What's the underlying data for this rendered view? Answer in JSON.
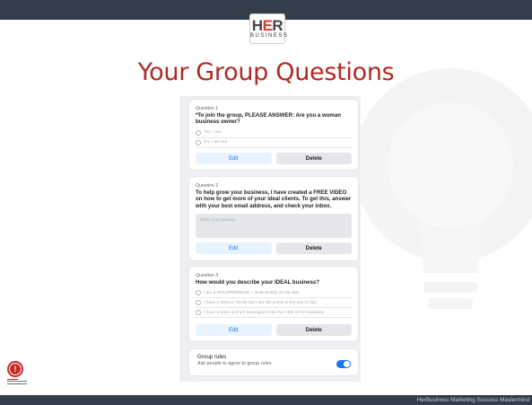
{
  "header": {
    "logo_top": "HER",
    "logo_sub": "BUSINESS"
  },
  "slide": {
    "title": "Your Group Questions"
  },
  "questions": [
    {
      "number": "Question 1",
      "text": "*To join the group, PLEASE ANSWER: Are you a woman business owner?",
      "options": [
        "Yes, I am",
        "No, I am not"
      ],
      "edit_label": "Edit",
      "delete_label": "Delete"
    },
    {
      "number": "Question 2",
      "text": "To help grow your business, I have created a FREE VIDEO on how to get more of your ideal clients. To get this, answer with your best email address, and check your inbox.",
      "answer_placeholder": "Write your answer...",
      "edit_label": "Edit",
      "delete_label": "Delete"
    },
    {
      "number": "Question 3",
      "text": "How would you describe your IDEAL business?",
      "options": [
        "I am a SOLOPRENEUR, I work mostly on my own",
        "I have a SMALL TEAM but I am still active in the day to day",
        "I have a team and am leveraged to be the CEO of the business"
      ],
      "edit_label": "Edit",
      "delete_label": "Delete"
    }
  ],
  "group_rules": {
    "title": "Group rules",
    "subtitle": "Ask people to agree to group rules.",
    "enabled": true
  },
  "footer": {
    "text": "HerBusiness Marketing Success Mastermind"
  },
  "colors": {
    "title_red": "#b22a25",
    "bar_dark": "#333e4b",
    "facebook_blue": "#1877f2"
  },
  "icons": {
    "watermark": "lightbulb-icon",
    "badge": "exclamation-badge-icon",
    "radio": "radio-button-icon",
    "toggle": "toggle-switch-icon"
  }
}
